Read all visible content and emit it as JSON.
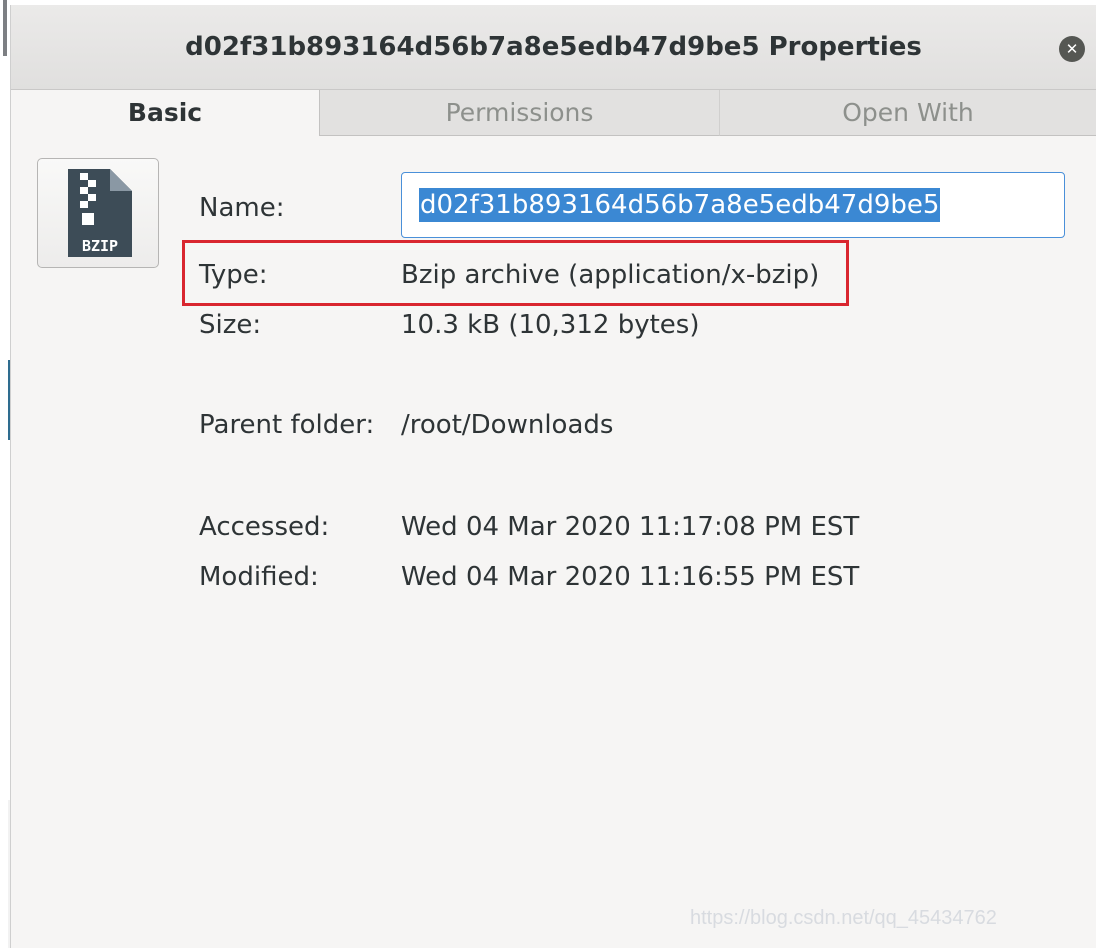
{
  "window": {
    "title": "d02f31b893164d56b7a8e5edb47d9be5 Properties",
    "close_symbol": "✕"
  },
  "tabs": [
    {
      "label": "Basic",
      "active": true
    },
    {
      "label": "Permissions",
      "active": false
    },
    {
      "label": "Open With",
      "active": false
    }
  ],
  "file_icon": {
    "icon": "bzip-archive-icon",
    "label": "BZIP"
  },
  "properties": {
    "name_label": "Name:",
    "name_value": "d02f31b893164d56b7a8e5edb47d9be5",
    "type_label": "Type:",
    "type_value": "Bzip archive (application/x-bzip)",
    "size_label": "Size:",
    "size_value": "10.3 kB (10,312 bytes)",
    "parent_label": "Parent folder:",
    "parent_value": "/root/Downloads",
    "accessed_label": "Accessed:",
    "accessed_value": "Wed 04 Mar 2020 11:17:08 PM EST",
    "modified_label": "Modified:",
    "modified_value": "Wed 04 Mar 2020 11:16:55 PM EST"
  },
  "colors": {
    "selection": "#3b88d3",
    "highlight_box": "#d9262f"
  },
  "watermark": "https://blog.csdn.net/qq_45434762"
}
